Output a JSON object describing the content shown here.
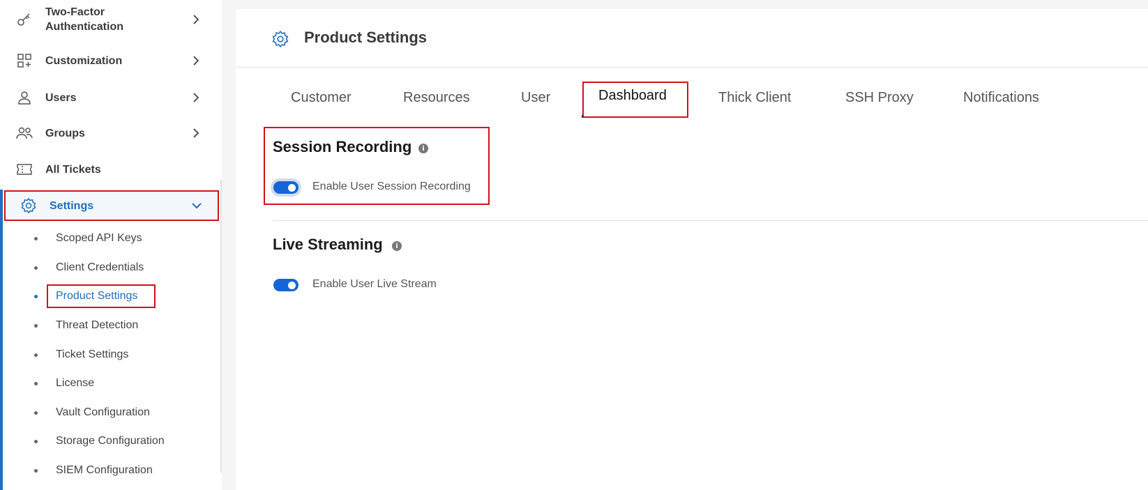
{
  "sidebar": {
    "items": [
      {
        "label": "Two-Factor Authentication",
        "icon": "key-icon"
      },
      {
        "label": "Customization",
        "icon": "grid-plus-icon"
      },
      {
        "label": "Users",
        "icon": "user-icon"
      },
      {
        "label": "Groups",
        "icon": "users-icon"
      },
      {
        "label": "All Tickets",
        "icon": "ticket-icon"
      },
      {
        "label": "Settings",
        "icon": "gear-icon"
      }
    ],
    "two_factor_line1": "Two-Factor",
    "two_factor_line2": "Authentication",
    "settings_subitems": [
      {
        "label": "Scoped API Keys"
      },
      {
        "label": "Client Credentials"
      },
      {
        "label": "Product Settings"
      },
      {
        "label": "Threat Detection"
      },
      {
        "label": "Ticket Settings"
      },
      {
        "label": "License"
      },
      {
        "label": "Vault Configuration"
      },
      {
        "label": "Storage Configuration"
      },
      {
        "label": "SIEM Configuration"
      }
    ]
  },
  "header": {
    "title": "Product Settings"
  },
  "tabs": [
    {
      "label": "Customer"
    },
    {
      "label": "Resources"
    },
    {
      "label": "User"
    },
    {
      "label": "Dashboard"
    },
    {
      "label": "Thick Client"
    },
    {
      "label": "SSH Proxy"
    },
    {
      "label": "Notifications"
    }
  ],
  "active_tab": "Dashboard",
  "sections": {
    "session_recording": {
      "title": "Session Recording",
      "toggle_label": "Enable User Session Recording",
      "enabled": true
    },
    "live_streaming": {
      "title": "Live Streaming",
      "toggle_label": "Enable User Live Stream",
      "enabled": true
    }
  },
  "colors": {
    "accent": "#1f6fbf",
    "toggle": "#1565d8",
    "highlight_border": "#d0121b"
  }
}
